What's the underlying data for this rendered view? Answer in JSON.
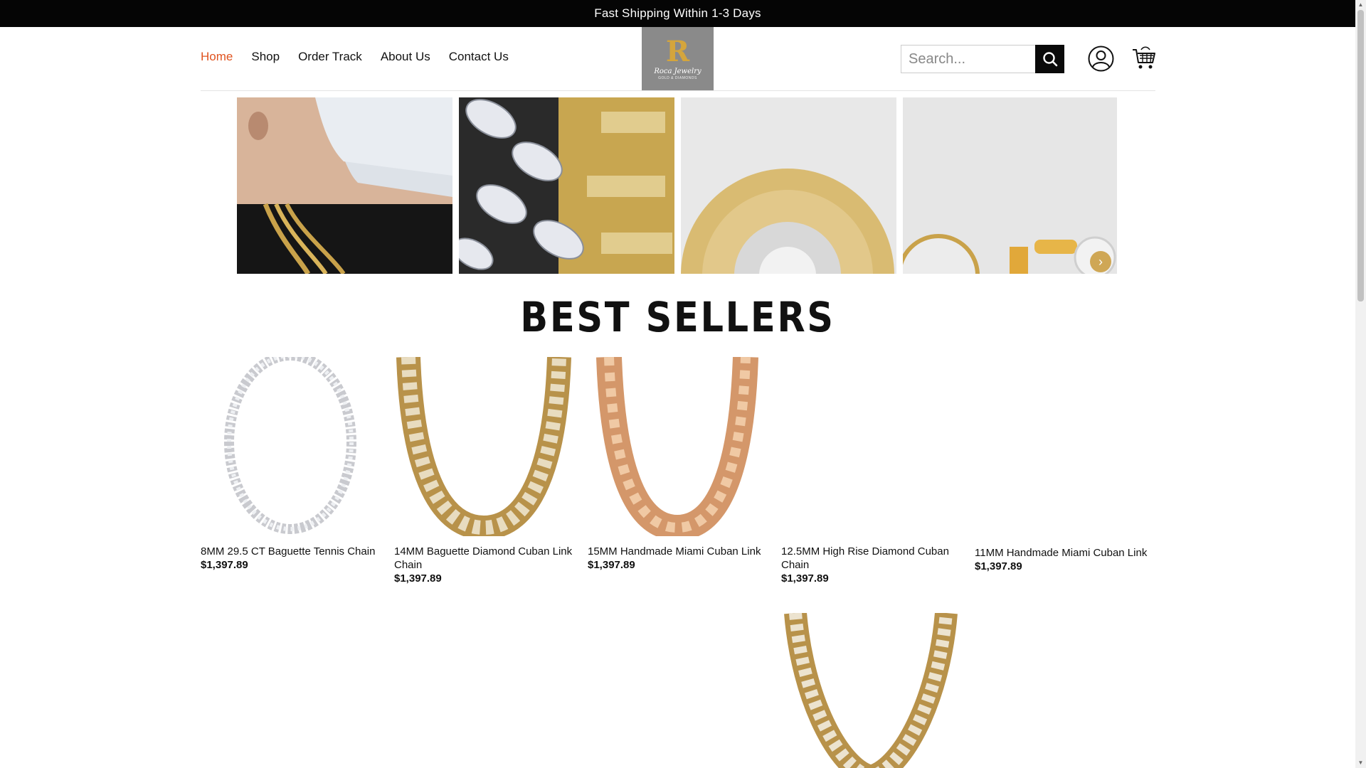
{
  "announcement": "Fast Shipping Within 1-3 Days",
  "nav": [
    {
      "label": "Home",
      "active": true
    },
    {
      "label": "Shop",
      "active": false
    },
    {
      "label": "Order Track",
      "active": false
    },
    {
      "label": "About Us",
      "active": false
    },
    {
      "label": "Contact Us",
      "active": false
    }
  ],
  "logo": {
    "mono": "R",
    "script": "Roca Jewelry",
    "tag": "GOLD & DIAMONDS"
  },
  "search": {
    "placeholder": "Search..."
  },
  "icons": {
    "search": "search-icon",
    "account": "account-icon",
    "cart": "cart-icon",
    "next": "chevron-right-icon"
  },
  "section_title": "BEST SELLERS",
  "products": [
    {
      "name": "8MM 29.5 CT Baguette Tennis Chain",
      "price": "$1,397.89"
    },
    {
      "name": "14MM Baguette Diamond Cuban Link Chain",
      "price": "$1,397.89"
    },
    {
      "name": "15MM Handmade Miami Cuban Link",
      "price": "$1,397.89"
    },
    {
      "name": "12.5MM High Rise Diamond Cuban Chain",
      "price": "$1,397.89"
    },
    {
      "name": "11MM Handmade Miami Cuban Link",
      "price": "$1,397.89"
    }
  ],
  "colors": {
    "accent": "#e0531f",
    "topbar": "#050505",
    "gold": "#c99a3a"
  }
}
